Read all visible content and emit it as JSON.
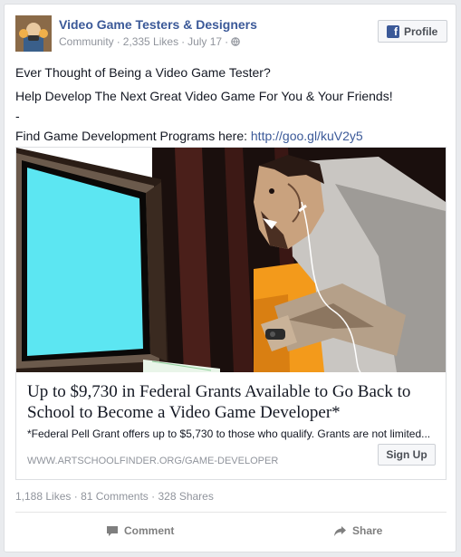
{
  "page": {
    "name": "Video Game Testers & Designers",
    "category": "Community",
    "likes": "2,335 Likes",
    "date": "July 17",
    "separator": "·",
    "profile_button": "Profile"
  },
  "post": {
    "line1": "Ever Thought of Being a Video Game Tester?",
    "line2": "Help Develop The Next Great Video Game For You & Your Friends!",
    "line3": "-",
    "line4_prefix": "Find Game Development Programs here: ",
    "line4_link": "http://goo.gl/kuV2y5"
  },
  "attachment": {
    "title": "Up to $9,730 in Federal Grants Available to Go Back to School to Become a Video Game Developer*",
    "description": "*Federal Pell Grant offers up to $5,730 to those who qualify. Grants are not limited...",
    "domain": "WWW.ARTSCHOOLFINDER.ORG/GAME-DEVELOPER",
    "cta": "Sign Up"
  },
  "stats": {
    "likes": "1,188 Likes",
    "comments": "81 Comments",
    "shares": "328 Shares"
  },
  "actions": {
    "comment": "Comment",
    "share": "Share"
  },
  "colors": {
    "link": "#3b5998",
    "muted": "#90949c",
    "screen": "#5ce6f2",
    "accent_orange": "#f39a1b"
  }
}
